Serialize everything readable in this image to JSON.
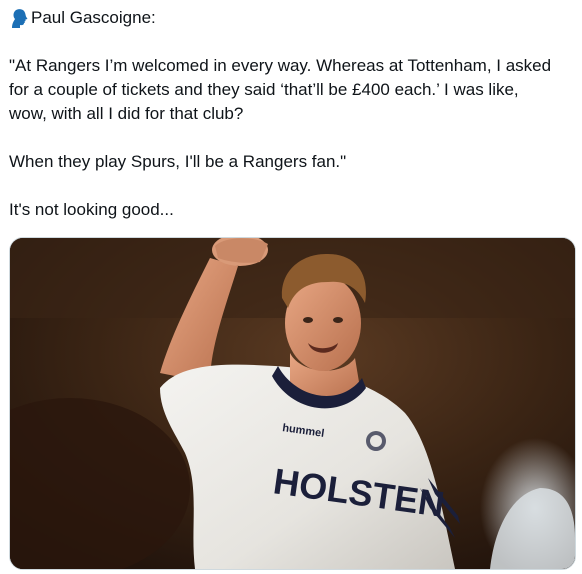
{
  "post": {
    "speaker_icon": "speaking-head-icon",
    "speaker_name": "Paul Gascoigne:",
    "quote_lines": [
      "\"At Rangers I’m welcomed in every way. Whereas at Tottenham, I asked",
      "for a couple of tickets and they said ‘that’ll be £400 each.’ I was like,",
      "wow, with all I did for that club?"
    ],
    "quote_end": "When they play Spurs, I'll be a Rangers fan.\"",
    "comment": "It's not looking good..."
  },
  "media": {
    "shirt_brand": "hummel",
    "shirt_sponsor": "HOLSTEN"
  },
  "colors": {
    "text": "#0f1419",
    "border": "#cfd9de",
    "speaker_icon": "#1c6fb5"
  }
}
